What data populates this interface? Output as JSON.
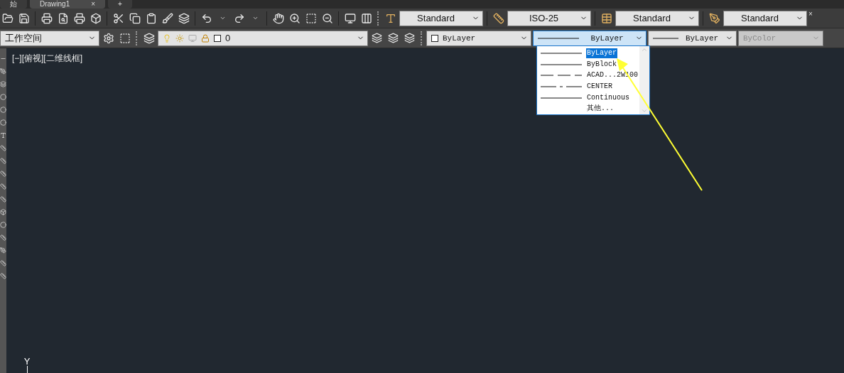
{
  "doc_tabs": [
    {
      "label": "始",
      "selected": false
    },
    {
      "label": "Drawing1",
      "selected": true,
      "close": "×"
    },
    {
      "label": "+",
      "selected": false
    }
  ],
  "style_toolbar": {
    "combos": [
      {
        "kind": "text",
        "value": "Standard"
      },
      {
        "kind": "dim",
        "value": "ISO-25"
      },
      {
        "kind": "table",
        "value": "Standard"
      },
      {
        "kind": "leader",
        "value": "Standard"
      }
    ],
    "close": "×"
  },
  "workspace": {
    "value": "工作空间"
  },
  "layer": {
    "value": "0"
  },
  "properties": [
    {
      "kind": "color",
      "value": "ByLayer",
      "active": false,
      "disabled": false
    },
    {
      "kind": "linetype",
      "value": "ByLayer",
      "active": true,
      "disabled": false
    },
    {
      "kind": "lineweight",
      "value": "ByLayer",
      "active": false,
      "disabled": false
    },
    {
      "kind": "plotstyle",
      "value": "ByColor",
      "active": false,
      "disabled": true
    }
  ],
  "linetype_list": [
    {
      "kind": "solid",
      "label": "ByLayer",
      "selected": true
    },
    {
      "kind": "solid",
      "label": "ByBlock",
      "selected": false
    },
    {
      "kind": "dashed",
      "label": "ACAD...2W100",
      "selected": false
    },
    {
      "kind": "center",
      "label": "CENTER",
      "selected": false
    },
    {
      "kind": "solid",
      "label": "Continuous",
      "selected": false
    },
    {
      "kind": "none",
      "label": "其他...",
      "selected": false
    }
  ],
  "viewport": {
    "label": "[−][俯视][二维线框]",
    "ucs_label": "Y"
  }
}
